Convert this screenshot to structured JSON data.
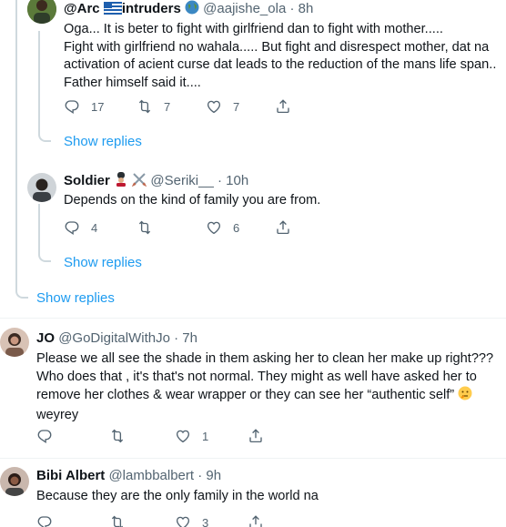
{
  "tweets": [
    {
      "name": "@Arc",
      "name_suffix": "intruders",
      "handle": "@aajishe_ola",
      "time": "8h",
      "lines": [
        "Oga... It is beter to fight with girlfriend dan to fight with mother.....",
        "Fight with girlfriend no wahala..... But fight and disrespect mother, dat na",
        "activation of acient curse dat leads to the reduction of the mans life span..",
        "Father himself said it...."
      ],
      "replies": "17",
      "retweets": "7",
      "likes": "7",
      "show_replies": "Show replies"
    },
    {
      "name": "Soldier",
      "handle": "@Seriki__",
      "time": "10h",
      "lines": [
        "Depends on the kind of family you are from."
      ],
      "replies": "4",
      "retweets": "",
      "likes": "6",
      "show_replies": "Show replies"
    },
    {
      "show_replies": "Show replies"
    },
    {
      "name": "JO",
      "handle": "@GoDigitalWithJo",
      "time": "7h",
      "lines": [
        "Please we all see the shade in them asking her to clean her make up right???",
        "Who does that , it's that's not normal. They might as well have asked her to",
        "remove her clothes &  wear wrapper or they can see her “authentic self”",
        "weyrey"
      ],
      "replies": "",
      "retweets": "",
      "likes": "1"
    },
    {
      "name": "Bibi Albert",
      "handle": "@lambbalbert",
      "time": "9h",
      "lines": [
        "Because they are the only family in the world na"
      ],
      "replies": "",
      "retweets": "",
      "likes": "3"
    }
  ],
  "separator": "·",
  "icons": [
    "reply-icon",
    "retweet-icon",
    "like-icon",
    "share-icon",
    "flag-emoji-icon",
    "globe-emoji-icon",
    "guard-emoji-icon",
    "crossed-swords-emoji-icon",
    "thinking-emoji-icon"
  ],
  "colors": {
    "link": "#1d9bf0",
    "muted": "#536471",
    "line": "#cfd9de"
  }
}
